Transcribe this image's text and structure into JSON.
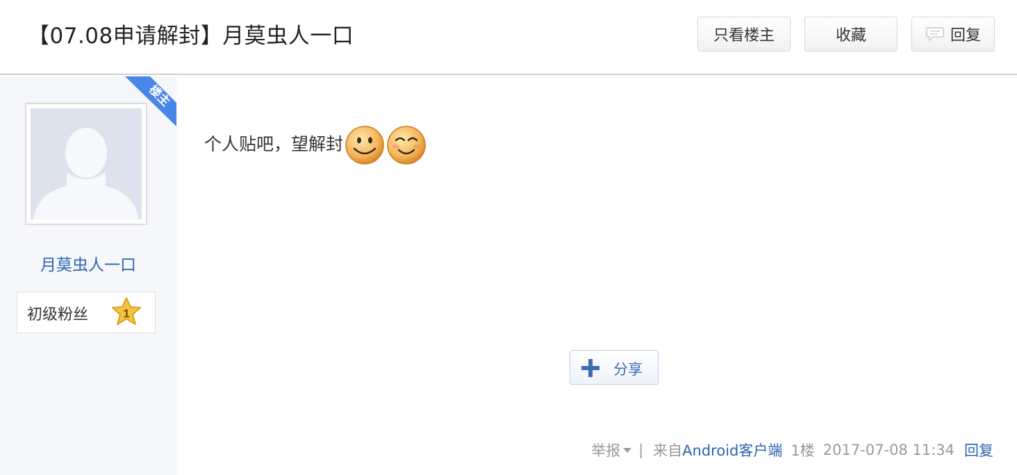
{
  "header": {
    "title": "【07.08申请解封】月莫虫人一口",
    "buttons": {
      "only_op": "只看楼主",
      "favorite": "收藏",
      "reply": "回复"
    }
  },
  "author": {
    "op_badge": "楼主",
    "name": "月莫虫人一口",
    "level_name": "初级粉丝",
    "level": "1"
  },
  "post": {
    "text": "个人贴吧，望解封",
    "emojis": [
      "smile-emoji",
      "squint-smile-emoji"
    ],
    "share_label": "分享"
  },
  "footer": {
    "report": "举报",
    "separator": "|",
    "source_prefix": "来自",
    "source_client": "Android客户端",
    "floor": "1楼",
    "time": "2017-07-08 11:34",
    "reply": "回复"
  },
  "colors": {
    "link": "#2d64b3",
    "badge": "#4a86e8",
    "sidebar_bg": "#f5f7fb",
    "star": "#f5c342"
  }
}
